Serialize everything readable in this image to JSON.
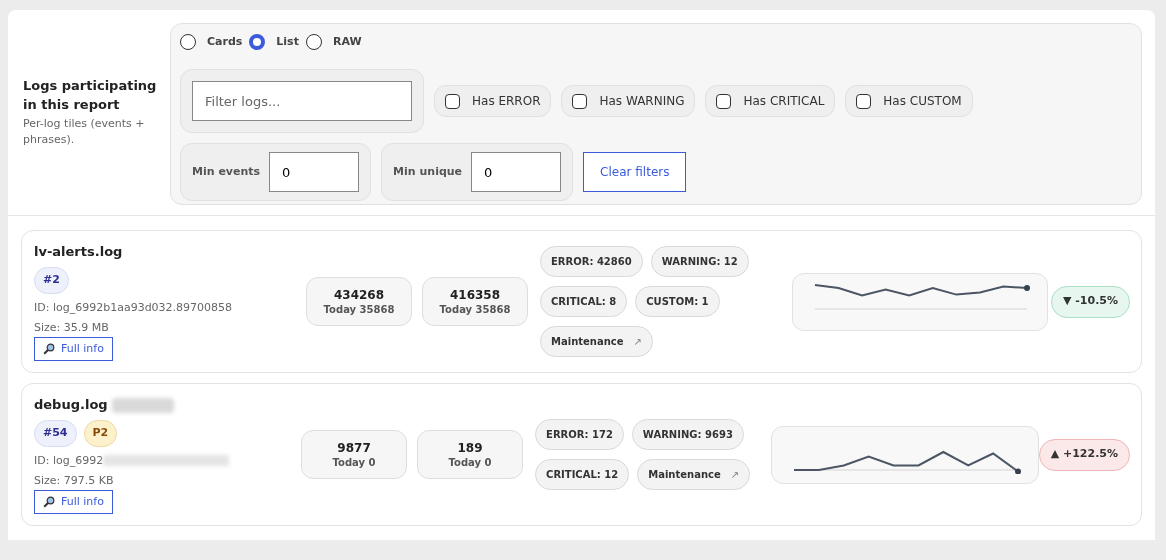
{
  "view_modes": [
    {
      "label": "Cards",
      "selected": false
    },
    {
      "label": "List",
      "selected": true
    },
    {
      "label": "RAW",
      "selected": false
    }
  ],
  "section": {
    "title": "Logs participating in this report",
    "subtitle": "Per-log tiles (events + phrases)."
  },
  "filter": {
    "placeholder": "Filter logs..."
  },
  "checkboxes": [
    {
      "label": "Has ERROR",
      "checked": false
    },
    {
      "label": "Has WARNING",
      "checked": false
    },
    {
      "label": "Has CRITICAL",
      "checked": false
    },
    {
      "label": "Has CUSTOM",
      "checked": false
    }
  ],
  "numeric_filters": [
    {
      "label": "Min events",
      "value": "0"
    },
    {
      "label": "Min unique",
      "value": "0"
    }
  ],
  "clear_button": "Clear filters",
  "logs": [
    {
      "name": "lv-alerts.log",
      "redacted": false,
      "badges": [
        {
          "text": "#2",
          "kind": "index"
        }
      ],
      "id": "ID: log_6992b1aa93d032.89700858",
      "size": "Size: 35.9 MB",
      "info_button": "Full info",
      "stats": [
        {
          "value": "434268",
          "today": "Today 35868"
        },
        {
          "value": "416358",
          "today": "Today 35868"
        }
      ],
      "tags": [
        {
          "text": "ERROR: 42860"
        },
        {
          "text": "WARNING: 12"
        },
        {
          "text": "CRITICAL: 8"
        },
        {
          "text": "CUSTOM: 1"
        },
        {
          "text": "Maintenance",
          "arrow": "↗"
        }
      ],
      "trend": {
        "text": "▼ -10.5%",
        "kind": "down"
      }
    },
    {
      "name": "debug.log",
      "redacted": true,
      "badges": [
        {
          "text": "#54",
          "kind": "index"
        },
        {
          "text": "P2",
          "kind": "priority"
        }
      ],
      "id": "ID: log_6992",
      "size": "Size: 797.5 KB",
      "info_button": "Full info",
      "stats": [
        {
          "value": "9877",
          "today": "Today 0"
        },
        {
          "value": "189",
          "today": "Today 0"
        }
      ],
      "tags": [
        {
          "text": "ERROR: 172"
        },
        {
          "text": "WARNING: 9693"
        },
        {
          "text": "CRITICAL: 12"
        },
        {
          "text": "Maintenance",
          "arrow": "↗"
        }
      ],
      "trend": {
        "text": "▲ +122.5%",
        "kind": "up"
      }
    }
  ]
}
